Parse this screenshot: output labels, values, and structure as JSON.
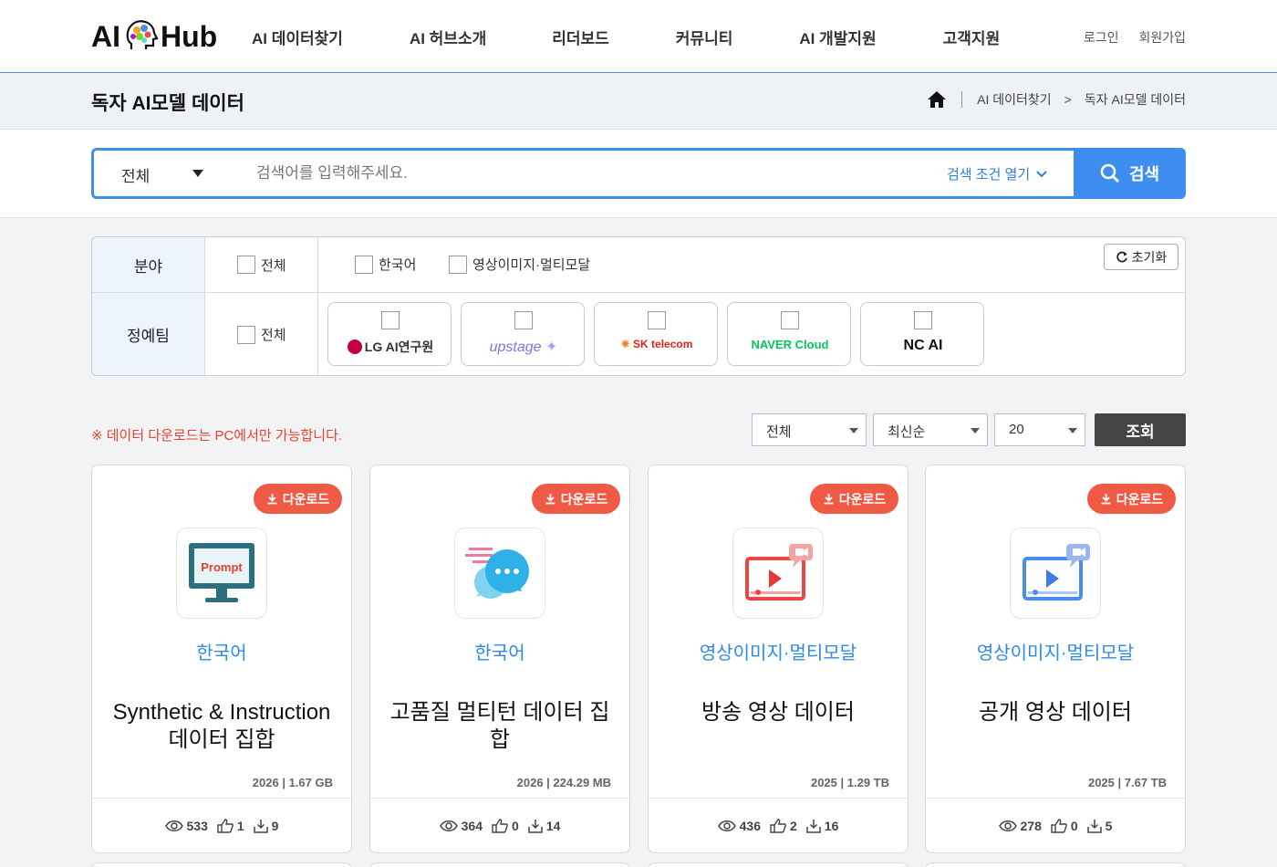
{
  "header": {
    "logo_left": "AI",
    "logo_right": "Hub",
    "nav": [
      "AI 데이터찾기",
      "AI 허브소개",
      "리더보드",
      "커뮤니티",
      "AI 개발지원",
      "고객지원"
    ],
    "login": "로그인",
    "signup": "회원가입"
  },
  "subbar": {
    "title": "독자 AI모델 데이터",
    "breadcrumb": [
      "AI 데이터찾기",
      ">",
      "독자 AI모델 데이터"
    ]
  },
  "search": {
    "scope": "전체",
    "placeholder": "검색어를 입력해주세요.",
    "advanced": "검색 조건 열기",
    "button": "검색"
  },
  "filters": {
    "field": {
      "label": "분야",
      "all": "전체",
      "options": [
        "한국어",
        "영상이미지·멀티모달"
      ]
    },
    "team": {
      "label": "정예팀",
      "all": "전체",
      "logos": [
        "LG AI연구원",
        "upstage",
        "SK telecom",
        "NAVER Cloud",
        "NC AI"
      ]
    },
    "reset": "초기화"
  },
  "toolbar": {
    "notice": "※ 데이터 다운로드는 PC에서만 가능합니다.",
    "filter_all": "전체",
    "sort": "최신순",
    "page_size": "20",
    "query": "조회"
  },
  "cards": [
    {
      "download": "다운로드",
      "category": "한국어",
      "title": "Synthetic & Instruction 데이터 집합",
      "meta": "2026 | 1.67 GB",
      "views": "533",
      "likes": "1",
      "downloads": "9",
      "thumb_icon": "prompt-monitor-icon",
      "thumb_text": "Prompt"
    },
    {
      "download": "다운로드",
      "category": "한국어",
      "title": "고품질 멀티턴 데이터 집합",
      "meta": "2026 | 224.29 MB",
      "views": "364",
      "likes": "0",
      "downloads": "14",
      "thumb_icon": "chat-bubble-icon"
    },
    {
      "download": "다운로드",
      "category": "영상이미지·멀티모달",
      "title": "방송 영상 데이터",
      "meta": "2025 | 1.29 TB",
      "views": "436",
      "likes": "2",
      "downloads": "16",
      "thumb_icon": "video-player-red-icon"
    },
    {
      "download": "다운로드",
      "category": "영상이미지·멀티모달",
      "title": "공개 영상 데이터",
      "meta": "2025 | 7.67 TB",
      "views": "278",
      "likes": "0",
      "downloads": "5",
      "thumb_icon": "video-player-blue-icon"
    }
  ],
  "colors": {
    "accent": "#3d8ef0",
    "download": "#ef5a45",
    "category": "#2f8ae6",
    "notice": "#e8412c"
  }
}
